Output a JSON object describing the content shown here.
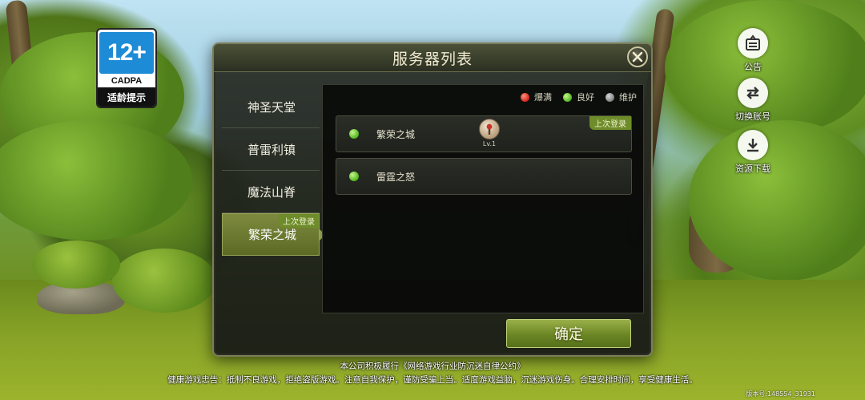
{
  "age_rating": {
    "age": "12+",
    "org": "CADPA",
    "tip": "适龄提示"
  },
  "side_buttons": [
    {
      "label": "公告",
      "icon": "notice-icon"
    },
    {
      "label": "切换账号",
      "icon": "switch-account-icon"
    },
    {
      "label": "资源下载",
      "icon": "download-icon"
    }
  ],
  "modal": {
    "title": "服务器列表",
    "close_icon": "close-icon"
  },
  "regions": [
    {
      "label": "神圣天堂",
      "active": false
    },
    {
      "label": "普雷利镇",
      "active": false
    },
    {
      "label": "魔法山脊",
      "active": false
    },
    {
      "label": "繁荣之城",
      "active": true,
      "tag": "上次登录"
    }
  ],
  "legend": [
    {
      "label": "爆满",
      "color": "red"
    },
    {
      "label": "良好",
      "color": "green"
    },
    {
      "label": "维护",
      "color": "gray"
    }
  ],
  "servers": [
    {
      "name": "繁荣之城",
      "status": "green",
      "tag": "上次登录",
      "character_level": "Lv.1"
    },
    {
      "name": "雷霆之怒",
      "status": "green"
    }
  ],
  "confirm_label": "确定",
  "footer": {
    "line1": "本公司积极履行《网络游戏行业防沉迷自律公约》",
    "line2": "健康游戏忠告：抵制不良游戏，拒绝盗版游戏。注意自我保护，谨防受骗上当。适度游戏益脑，沉迷游戏伤身。合理安排时间，享受健康生活。",
    "version": "版本号:148554_31931"
  }
}
